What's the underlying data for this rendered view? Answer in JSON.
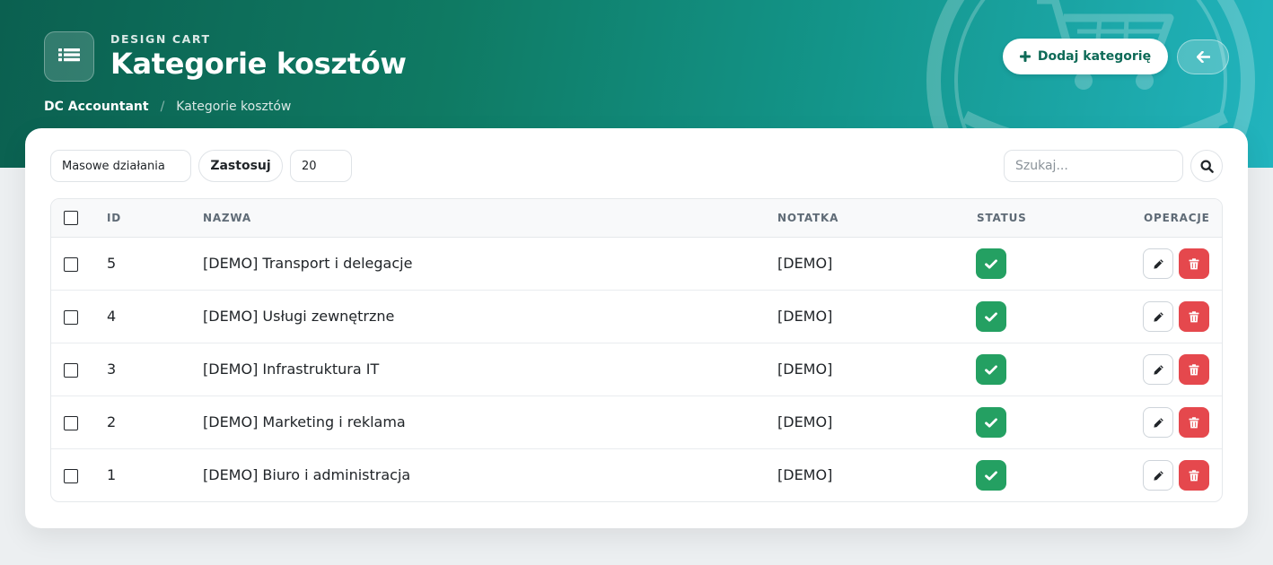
{
  "header": {
    "app_caption": "DESIGN CART",
    "title": "Kategorie kosztów",
    "breadcrumb": {
      "root": "DC Accountant",
      "separator": "/",
      "current": "Kategorie kosztów"
    },
    "add_button_label": "Dodaj kategorię",
    "icons": {
      "app": "list-icon",
      "add": "plus-icon",
      "back": "arrow-left-icon"
    }
  },
  "toolbar": {
    "bulk_actions_value": "Masowe działania",
    "apply_label": "Zastosuj",
    "per_page_value": "20",
    "search_placeholder": "Szukaj..."
  },
  "table": {
    "columns": {
      "id": "ID",
      "name": "NAZWA",
      "note": "NOTATKA",
      "status": "STATUS",
      "actions": "OPERACJE"
    },
    "rows": [
      {
        "id": "5",
        "name": "[DEMO] Transport i delegacje",
        "note": "[DEMO]",
        "active": true
      },
      {
        "id": "4",
        "name": "[DEMO] Usługi zewnętrzne",
        "note": "[DEMO]",
        "active": true
      },
      {
        "id": "3",
        "name": "[DEMO] Infrastruktura IT",
        "note": "[DEMO]",
        "active": true
      },
      {
        "id": "2",
        "name": "[DEMO] Marketing i reklama",
        "note": "[DEMO]",
        "active": true
      },
      {
        "id": "1",
        "name": "[DEMO] Biuro i administracja",
        "note": "[DEMO]",
        "active": true
      }
    ]
  },
  "colors": {
    "header_start": "#0b6050",
    "header_end": "#22b4be",
    "status_active": "#24a062",
    "delete": "#e5484d",
    "accent_text": "#0e6a57"
  }
}
